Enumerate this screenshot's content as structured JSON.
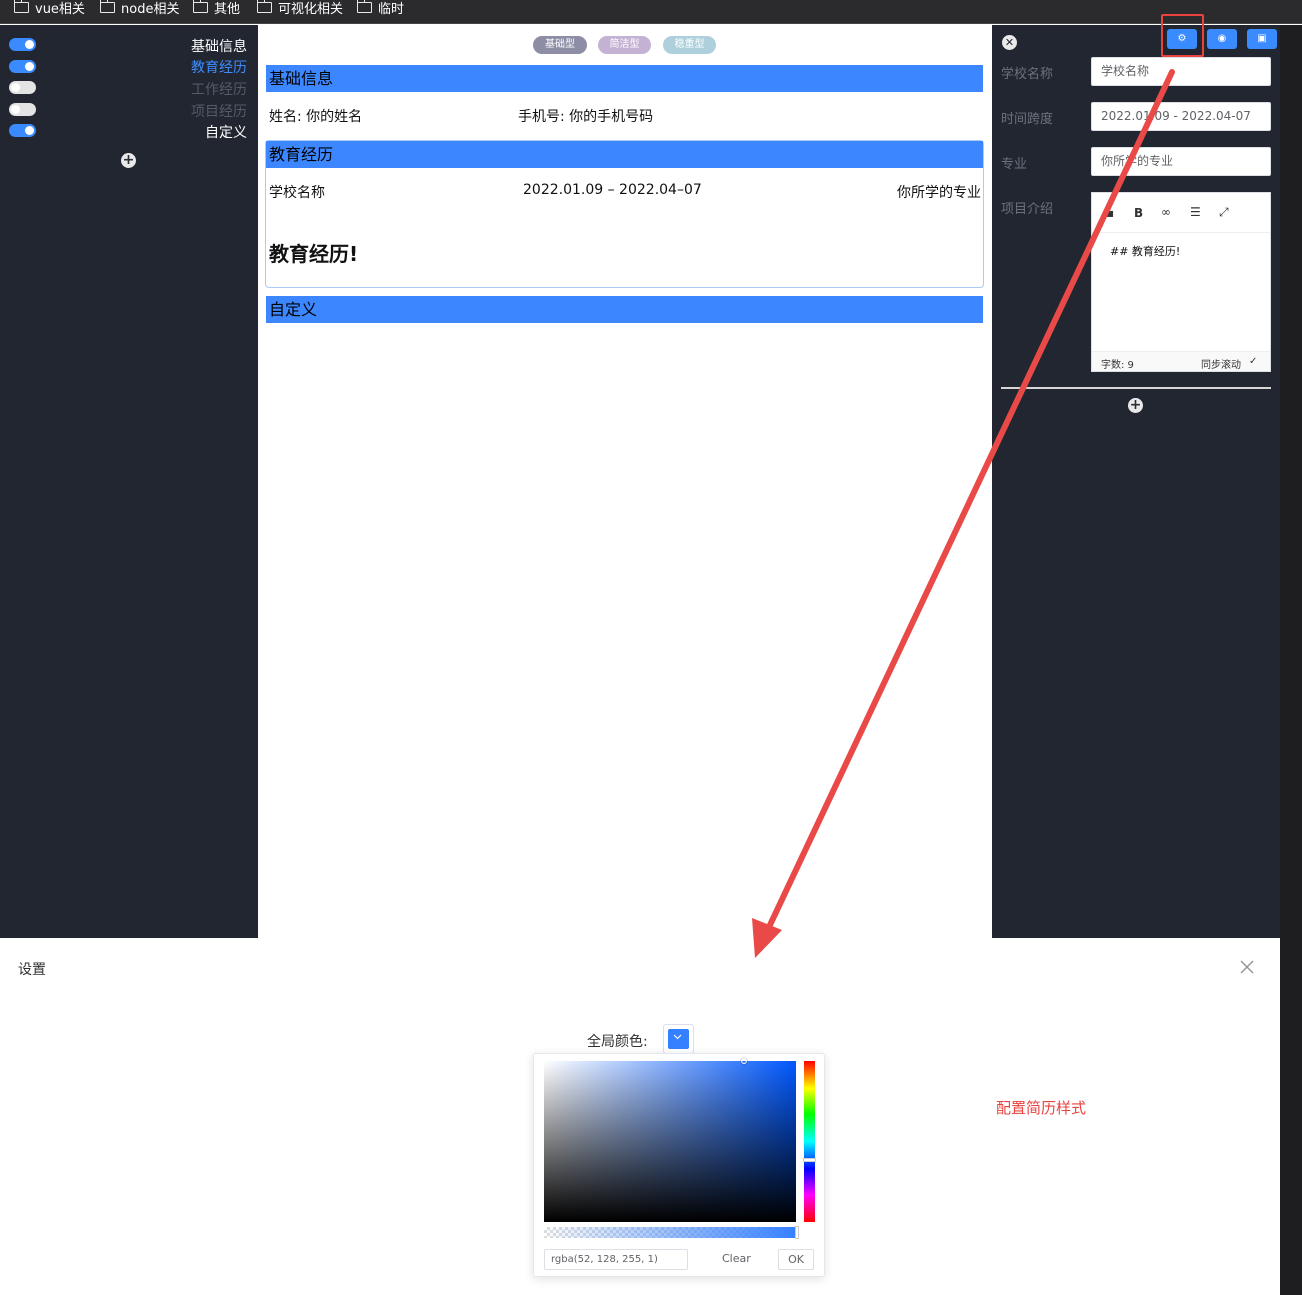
{
  "bookmarks": [
    "vue相关",
    "node相关",
    "其他",
    "可视化相关",
    "临时"
  ],
  "sidebar": {
    "sections": [
      {
        "label": "基础信息",
        "enabled": true,
        "state": "normal"
      },
      {
        "label": "教育经历",
        "enabled": true,
        "state": "active"
      },
      {
        "label": "工作经历",
        "enabled": false,
        "state": "disabled"
      },
      {
        "label": "项目经历",
        "enabled": false,
        "state": "disabled"
      },
      {
        "label": "自定义",
        "enabled": true,
        "state": "normal"
      }
    ]
  },
  "preview": {
    "style_buttons": [
      "基础型",
      "简洁型",
      "稳重型"
    ],
    "basic_title": "基础信息",
    "name_text": "姓名: 你的姓名",
    "phone_text": "手机号: 你的手机号码",
    "edu_title": "教育经历",
    "school": "学校名称",
    "date_range": "2022.01.09 – 2022.04–07",
    "major": "你所学的专业",
    "edu_heading": "教育经历!",
    "custom_title": "自定义"
  },
  "form": {
    "school_label": "学校名称",
    "school_value": "学校名称",
    "time_label": "时间跨度",
    "time_value": "2022.01.09 - 2022.04-07",
    "major_label": "专业",
    "major_value": "你所学的专业",
    "intro_label": "项目介绍",
    "editor_content": "## 教育经历!",
    "word_count": "字数: 9",
    "sync_scroll": "同步滚动"
  },
  "dialog": {
    "title": "设置",
    "color_label": "全局颜色:",
    "color_value": "rgba(52, 128, 255, 1)",
    "clear_label": "Clear",
    "ok_label": "OK"
  },
  "annotation": "配置简历样式",
  "colors": {
    "accent": "#3480ff",
    "dark_bg": "#222631",
    "annotation_red": "#e8433f"
  }
}
